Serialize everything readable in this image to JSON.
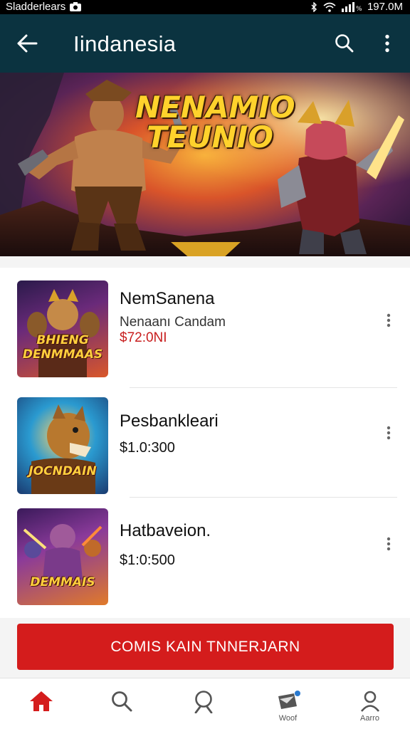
{
  "status_bar": {
    "left_text": "Sladderlears",
    "right_text": "197.0M"
  },
  "app_bar": {
    "title": "Iindanesia"
  },
  "banner": {
    "title_line1": "NENAMIO",
    "title_line2": "TEUNIO",
    "page_count": 4,
    "active_page": 1
  },
  "items": [
    {
      "name": "NemSanena",
      "subtitle": "Nenaanı Candam",
      "price": "$72:0NI",
      "price_color": "#c81e1e",
      "thumb_label": "BHIENG DENMMAAS"
    },
    {
      "name": "Pesbankleari",
      "subtitle": "",
      "price": "$1.0:300",
      "price_color": "#111111",
      "thumb_label": "JOCNDAIN"
    },
    {
      "name": "Hatbaveion.",
      "subtitle": "",
      "price": "$1:0:500",
      "price_color": "#111111",
      "thumb_label": "DEMMAIS"
    }
  ],
  "cta": {
    "label": "COMIS KAIN TNNERJARN"
  },
  "bottom_nav": [
    {
      "icon": "home-icon",
      "label": ""
    },
    {
      "icon": "search-icon",
      "label": ""
    },
    {
      "icon": "search-icon",
      "label": ""
    },
    {
      "icon": "inbox-icon",
      "label": "Woof"
    },
    {
      "icon": "profile-icon",
      "label": "Aarro"
    }
  ],
  "colors": {
    "app_bar": "#0b3340",
    "accent_red": "#d41c1c",
    "home_active": "#d41c1c"
  }
}
